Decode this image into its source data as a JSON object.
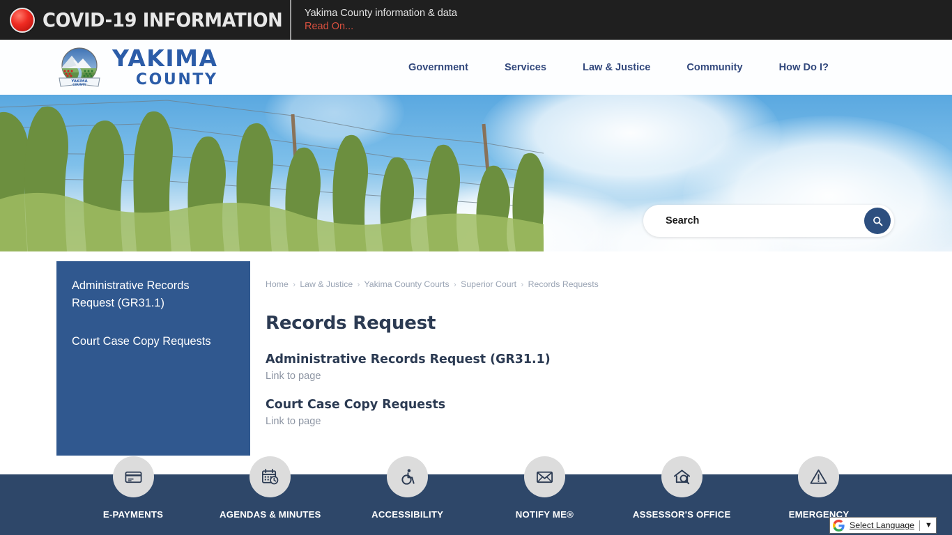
{
  "alert": {
    "icon": "alert-dot-icon",
    "title": "COVID-19 INFORMATION",
    "subtitle": "Yakima County information & data",
    "read_on": "Read On..."
  },
  "header": {
    "logo_alt": "Yakima County Seal",
    "brand_line1": "YAKIMA",
    "brand_line2": "COUNTY",
    "nav": [
      {
        "label": "Government"
      },
      {
        "label": "Services"
      },
      {
        "label": "Law & Justice"
      },
      {
        "label": "Community"
      },
      {
        "label": "How Do I?"
      }
    ]
  },
  "hero": {
    "search": {
      "placeholder": "Search",
      "value": "",
      "button_icon": "search-icon"
    }
  },
  "sidebar": {
    "items": [
      {
        "label": "Administrative Records Request (GR31.1)"
      },
      {
        "label": "Court Case Copy Requests"
      }
    ]
  },
  "breadcrumb": {
    "items": [
      {
        "label": "Home"
      },
      {
        "label": "Law & Justice"
      },
      {
        "label": "Yakima County Courts"
      },
      {
        "label": "Superior Court"
      },
      {
        "label": "Records Requests"
      }
    ],
    "separator": "›"
  },
  "main": {
    "title": "Records Request",
    "links": [
      {
        "heading": "Administrative Records Request (GR31.1)",
        "sub": "Link to page"
      },
      {
        "heading": "Court Case Copy Requests",
        "sub": "Link to page"
      }
    ]
  },
  "quicklinks": [
    {
      "label": "E-PAYMENTS",
      "icon": "credit-card-icon"
    },
    {
      "label": "AGENDAS & MINUTES",
      "icon": "calendar-clock-icon"
    },
    {
      "label": "ACCESSIBILITY",
      "icon": "wheelchair-icon"
    },
    {
      "label": "NOTIFY ME®",
      "icon": "envelope-icon"
    },
    {
      "label": "ASSESSOR'S OFFICE",
      "icon": "house-search-icon"
    },
    {
      "label": "EMERGENCY",
      "icon": "warning-triangle-icon"
    }
  ],
  "translate": {
    "label": "Select Language",
    "caret": "▼",
    "icon": "google-logo-icon"
  },
  "colors": {
    "alert_bar": "#1f1f1f",
    "alert_accent": "#d9503f",
    "brand_blue": "#2b5ca8",
    "nav_blue": "#33497d",
    "sidebar_blue": "#30588f",
    "footer_blue": "#2e4769",
    "search_button": "#2d4f7f",
    "heading": "#2b3a52",
    "muted": "#8d95a3"
  }
}
